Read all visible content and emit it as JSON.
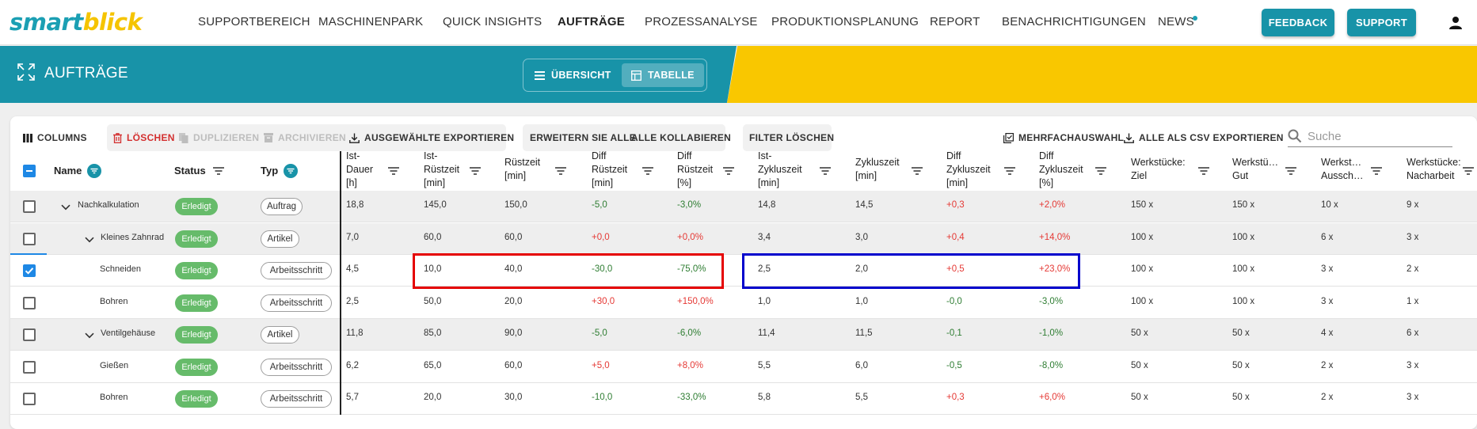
{
  "logo": {
    "smart": "smart",
    "blick": "blick"
  },
  "nav": [
    "SUPPORTBEREICH",
    "MASCHINENPARK",
    "QUICK INSIGHTS",
    "AUFTRÄGE",
    "PROZESSANALYSE",
    "PRODUKTIONSPLANUNG",
    "REPORT",
    "BENACHRICHTIGUNGEN",
    "NEWS"
  ],
  "nav_active": "AUFTRÄGE",
  "buttons": {
    "feedback": "FEEDBACK",
    "support": "SUPPORT"
  },
  "page_title": "AUFTRÄGE",
  "view_toggle": {
    "overview": "ÜBERSICHT",
    "table": "TABELLE",
    "selected": "TABELLE"
  },
  "toolbar": {
    "columns": "COLUMNS",
    "delete": "LÖSCHEN",
    "duplicate": "DUPLIZIEREN",
    "archive": "ARCHIVIEREN",
    "export_selected": "AUSGEWÄHLTE EXPORTIEREN",
    "expand_all": "ERWEITERN SIE ALLE",
    "collapse_all": "ALLE KOLLABIEREN",
    "clear_filter": "FILTER LÖSCHEN",
    "multi_select": "MEHRFACHAUSWAHL",
    "export_csv": "ALLE ALS CSV EXPORTIEREN",
    "search_placeholder": "Suche"
  },
  "columns": {
    "name": "Name",
    "status": "Status",
    "typ": "Typ",
    "c1": [
      "Ist-",
      "Dauer",
      "[h]"
    ],
    "c2": [
      "Ist-",
      "Rüstzeit",
      "[min]"
    ],
    "c3": [
      "Rüstzeit",
      "[min]"
    ],
    "c4": [
      "Diff",
      "Rüstzeit",
      "[min]"
    ],
    "c5": [
      "Diff",
      "Rüstzeit",
      "[%]"
    ],
    "c6": [
      "Ist-",
      "Zykluszeit",
      "[min]"
    ],
    "c7": [
      "Zykluszeit",
      "[min]"
    ],
    "c8": [
      "Diff",
      "Zykluszeit",
      "[min]"
    ],
    "c9": [
      "Diff",
      "Zykluszeit",
      "[%]"
    ],
    "c10": [
      "Werkstücke:",
      "Ziel"
    ],
    "c11": [
      "Werkstü…",
      "Gut"
    ],
    "c12": [
      "Werkst…",
      "Aussch…"
    ],
    "c13": [
      "Werkstücke:",
      "Nacharbeit"
    ]
  },
  "rows": [
    {
      "name": "Nachkalkulation",
      "status": "Erledigt",
      "typ": "Auftrag",
      "checked": false,
      "vals": [
        "18,8",
        "145,0",
        "150,0",
        "-5,0",
        "-3,0%",
        "14,8",
        "14,5",
        "+0,3",
        "+2,0%",
        "150 x",
        "150 x",
        "10 x",
        "9 x"
      ]
    },
    {
      "name": "Kleines Zahnrad",
      "status": "Erledigt",
      "typ": "Artikel",
      "checked": false,
      "vals": [
        "7,0",
        "60,0",
        "60,0",
        "+0,0",
        "+0,0%",
        "3,4",
        "3,0",
        "+0,4",
        "+14,0%",
        "100 x",
        "100 x",
        "6 x",
        "3 x"
      ]
    },
    {
      "name": "Schneiden",
      "status": "Erledigt",
      "typ": "Arbeitsschritt",
      "checked": true,
      "vals": [
        "4,5",
        "10,0",
        "40,0",
        "-30,0",
        "-75,0%",
        "2,5",
        "2,0",
        "+0,5",
        "+23,0%",
        "100 x",
        "100 x",
        "3 x",
        "2 x"
      ]
    },
    {
      "name": "Bohren",
      "status": "Erledigt",
      "typ": "Arbeitsschritt",
      "checked": false,
      "vals": [
        "2,5",
        "50,0",
        "20,0",
        "+30,0",
        "+150,0%",
        "1,0",
        "1,0",
        "-0,0",
        "-3,0%",
        "100 x",
        "100 x",
        "3 x",
        "1 x"
      ]
    },
    {
      "name": "Ventilgehäuse",
      "status": "Erledigt",
      "typ": "Artikel",
      "checked": false,
      "vals": [
        "11,8",
        "85,0",
        "90,0",
        "-5,0",
        "-6,0%",
        "11,4",
        "11,5",
        "-0,1",
        "-1,0%",
        "50 x",
        "50 x",
        "4 x",
        "6 x"
      ]
    },
    {
      "name": "Gießen",
      "status": "Erledigt",
      "typ": "Arbeitsschritt",
      "checked": false,
      "vals": [
        "6,2",
        "65,0",
        "60,0",
        "+5,0",
        "+8,0%",
        "5,5",
        "6,0",
        "-0,5",
        "-8,0%",
        "50 x",
        "50 x",
        "2 x",
        "3 x"
      ]
    },
    {
      "name": "Bohren",
      "status": "Erledigt",
      "typ": "Arbeitsschritt",
      "checked": false,
      "vals": [
        "5,7",
        "20,0",
        "30,0",
        "-10,0",
        "-33,0%",
        "5,8",
        "5,5",
        "+0,3",
        "+6,0%",
        "50 x",
        "50 x",
        "2 x",
        "3 x"
      ]
    }
  ],
  "colors": {
    "teal": "#1893a8",
    "yellow": "#f9c700",
    "positive": "#e53935",
    "negative": "#2e7d32",
    "highlight_red": "#e50000",
    "highlight_blue": "#0000cc"
  }
}
